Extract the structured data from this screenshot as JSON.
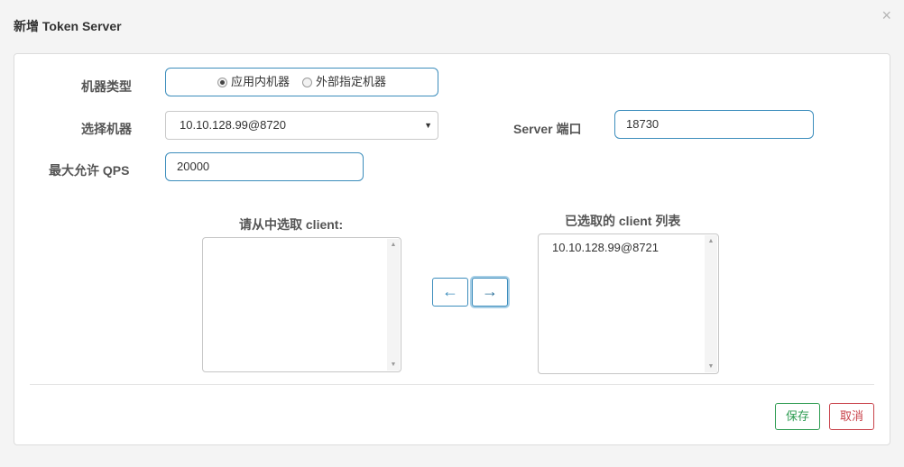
{
  "dialog": {
    "title": "新增 Token Server",
    "close_icon": "×"
  },
  "form": {
    "machine_type": {
      "label": "机器类型",
      "options": [
        {
          "label": "应用内机器",
          "selected": true
        },
        {
          "label": "外部指定机器",
          "selected": false
        }
      ]
    },
    "select_machine": {
      "label": "选择机器",
      "value": "10.10.128.99@8720"
    },
    "server_port": {
      "label": "Server 端口",
      "value": "18730"
    },
    "max_qps": {
      "label": "最大允许 QPS",
      "value": "20000"
    }
  },
  "clients": {
    "available_title": "请从中选取 client:",
    "available": [],
    "selected_title": "已选取的 client 列表",
    "selected": [
      "10.10.128.99@8721"
    ],
    "move_left_label": "←",
    "move_right_label": "→"
  },
  "footer": {
    "save_label": "保存",
    "cancel_label": "取消"
  },
  "colors": {
    "accent": "#3c8dbc",
    "save": "#2e9c52",
    "cancel": "#c8424a"
  }
}
